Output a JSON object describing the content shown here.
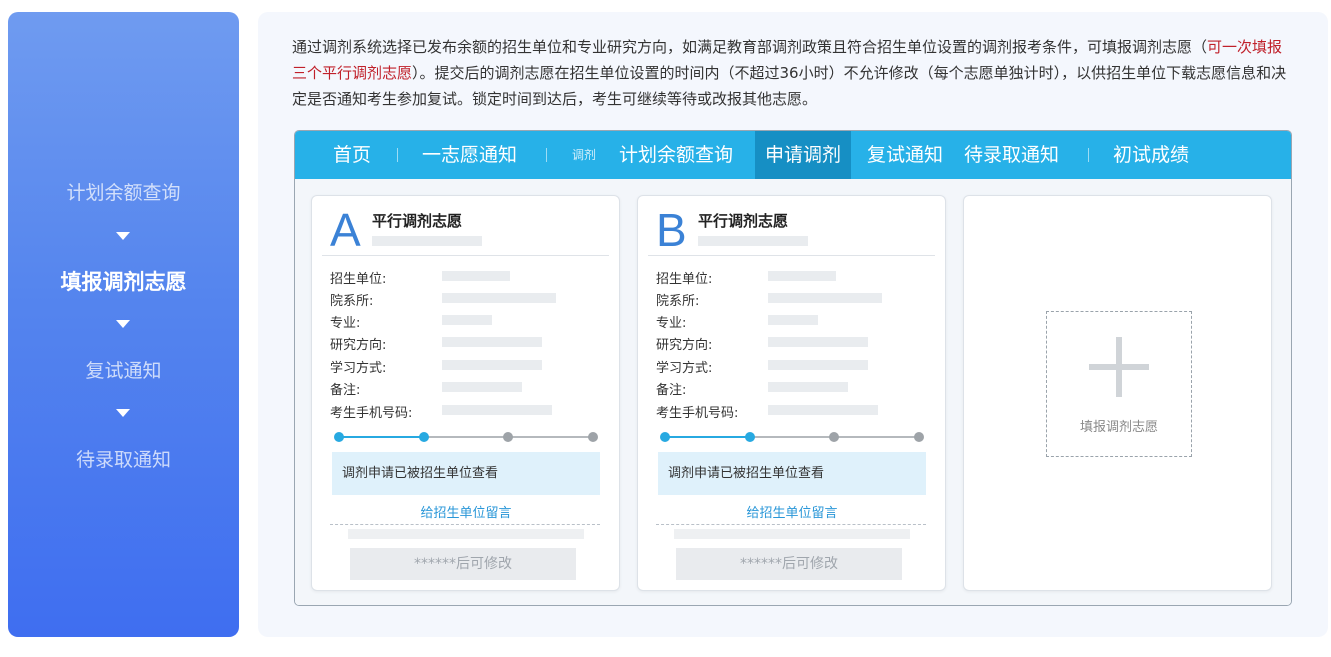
{
  "steps": [
    {
      "label": "计划余额查询",
      "active": false
    },
    {
      "label": "填报调剂志愿",
      "active": true
    },
    {
      "label": "复试通知",
      "active": false
    },
    {
      "label": "待录取通知",
      "active": false
    }
  ],
  "description": {
    "part1": "通过调剂系统选择已发布余额的招生单位和专业研究方向，如满足教育部调剂政策且符合招生单位设置的调剂报考条件，可填报调剂志愿（",
    "highlight": "可一次填报三个平行调剂志愿",
    "part2": "）。提交后的调剂志愿在招生单位设置的时间内（不超过36小时）不允许修改（每个志愿单独计时），以供招生单位下载志愿信息和决定是否通知考生参加复试。锁定时间到达后，考生可继续等待或改报其他志愿。",
    "highlight_color": "#c0202a"
  },
  "nav": {
    "items": [
      "首页",
      "一志愿通知",
      "调剂",
      "计划余额查询",
      "申请调剂",
      "复试通知",
      "待录取通知",
      "初试成绩"
    ],
    "active": "申请调剂",
    "bar_color": "#27b1e8",
    "active_color": "#168fc4"
  },
  "cards": [
    {
      "letter": "A",
      "title": "平行调剂志愿",
      "fields": [
        "招生单位:",
        "院系所:",
        "专业:",
        "研究方向:",
        "学习方式:",
        "备注:",
        "考生手机号码:"
      ],
      "progress_completed_steps": 2,
      "progress_total_steps": 4,
      "status": "调剂申请已被招生单位查看",
      "message_link": "给招生单位留言",
      "modify_button": "******后可修改"
    },
    {
      "letter": "B",
      "title": "平行调剂志愿",
      "fields": [
        "招生单位:",
        "院系所:",
        "专业:",
        "研究方向:",
        "学习方式:",
        "备注:",
        "考生手机号码:"
      ],
      "progress_completed_steps": 2,
      "progress_total_steps": 4,
      "status": "调剂申请已被招生单位查看",
      "message_link": "给招生单位留言",
      "modify_button": "******后可修改"
    }
  ],
  "add_card": {
    "label": "填报调剂志愿",
    "icon": "plus-icon"
  },
  "colors": {
    "accent_blue": "#3b82d6",
    "link_blue": "#2a97d8",
    "status_bg": "#dff1fb"
  }
}
